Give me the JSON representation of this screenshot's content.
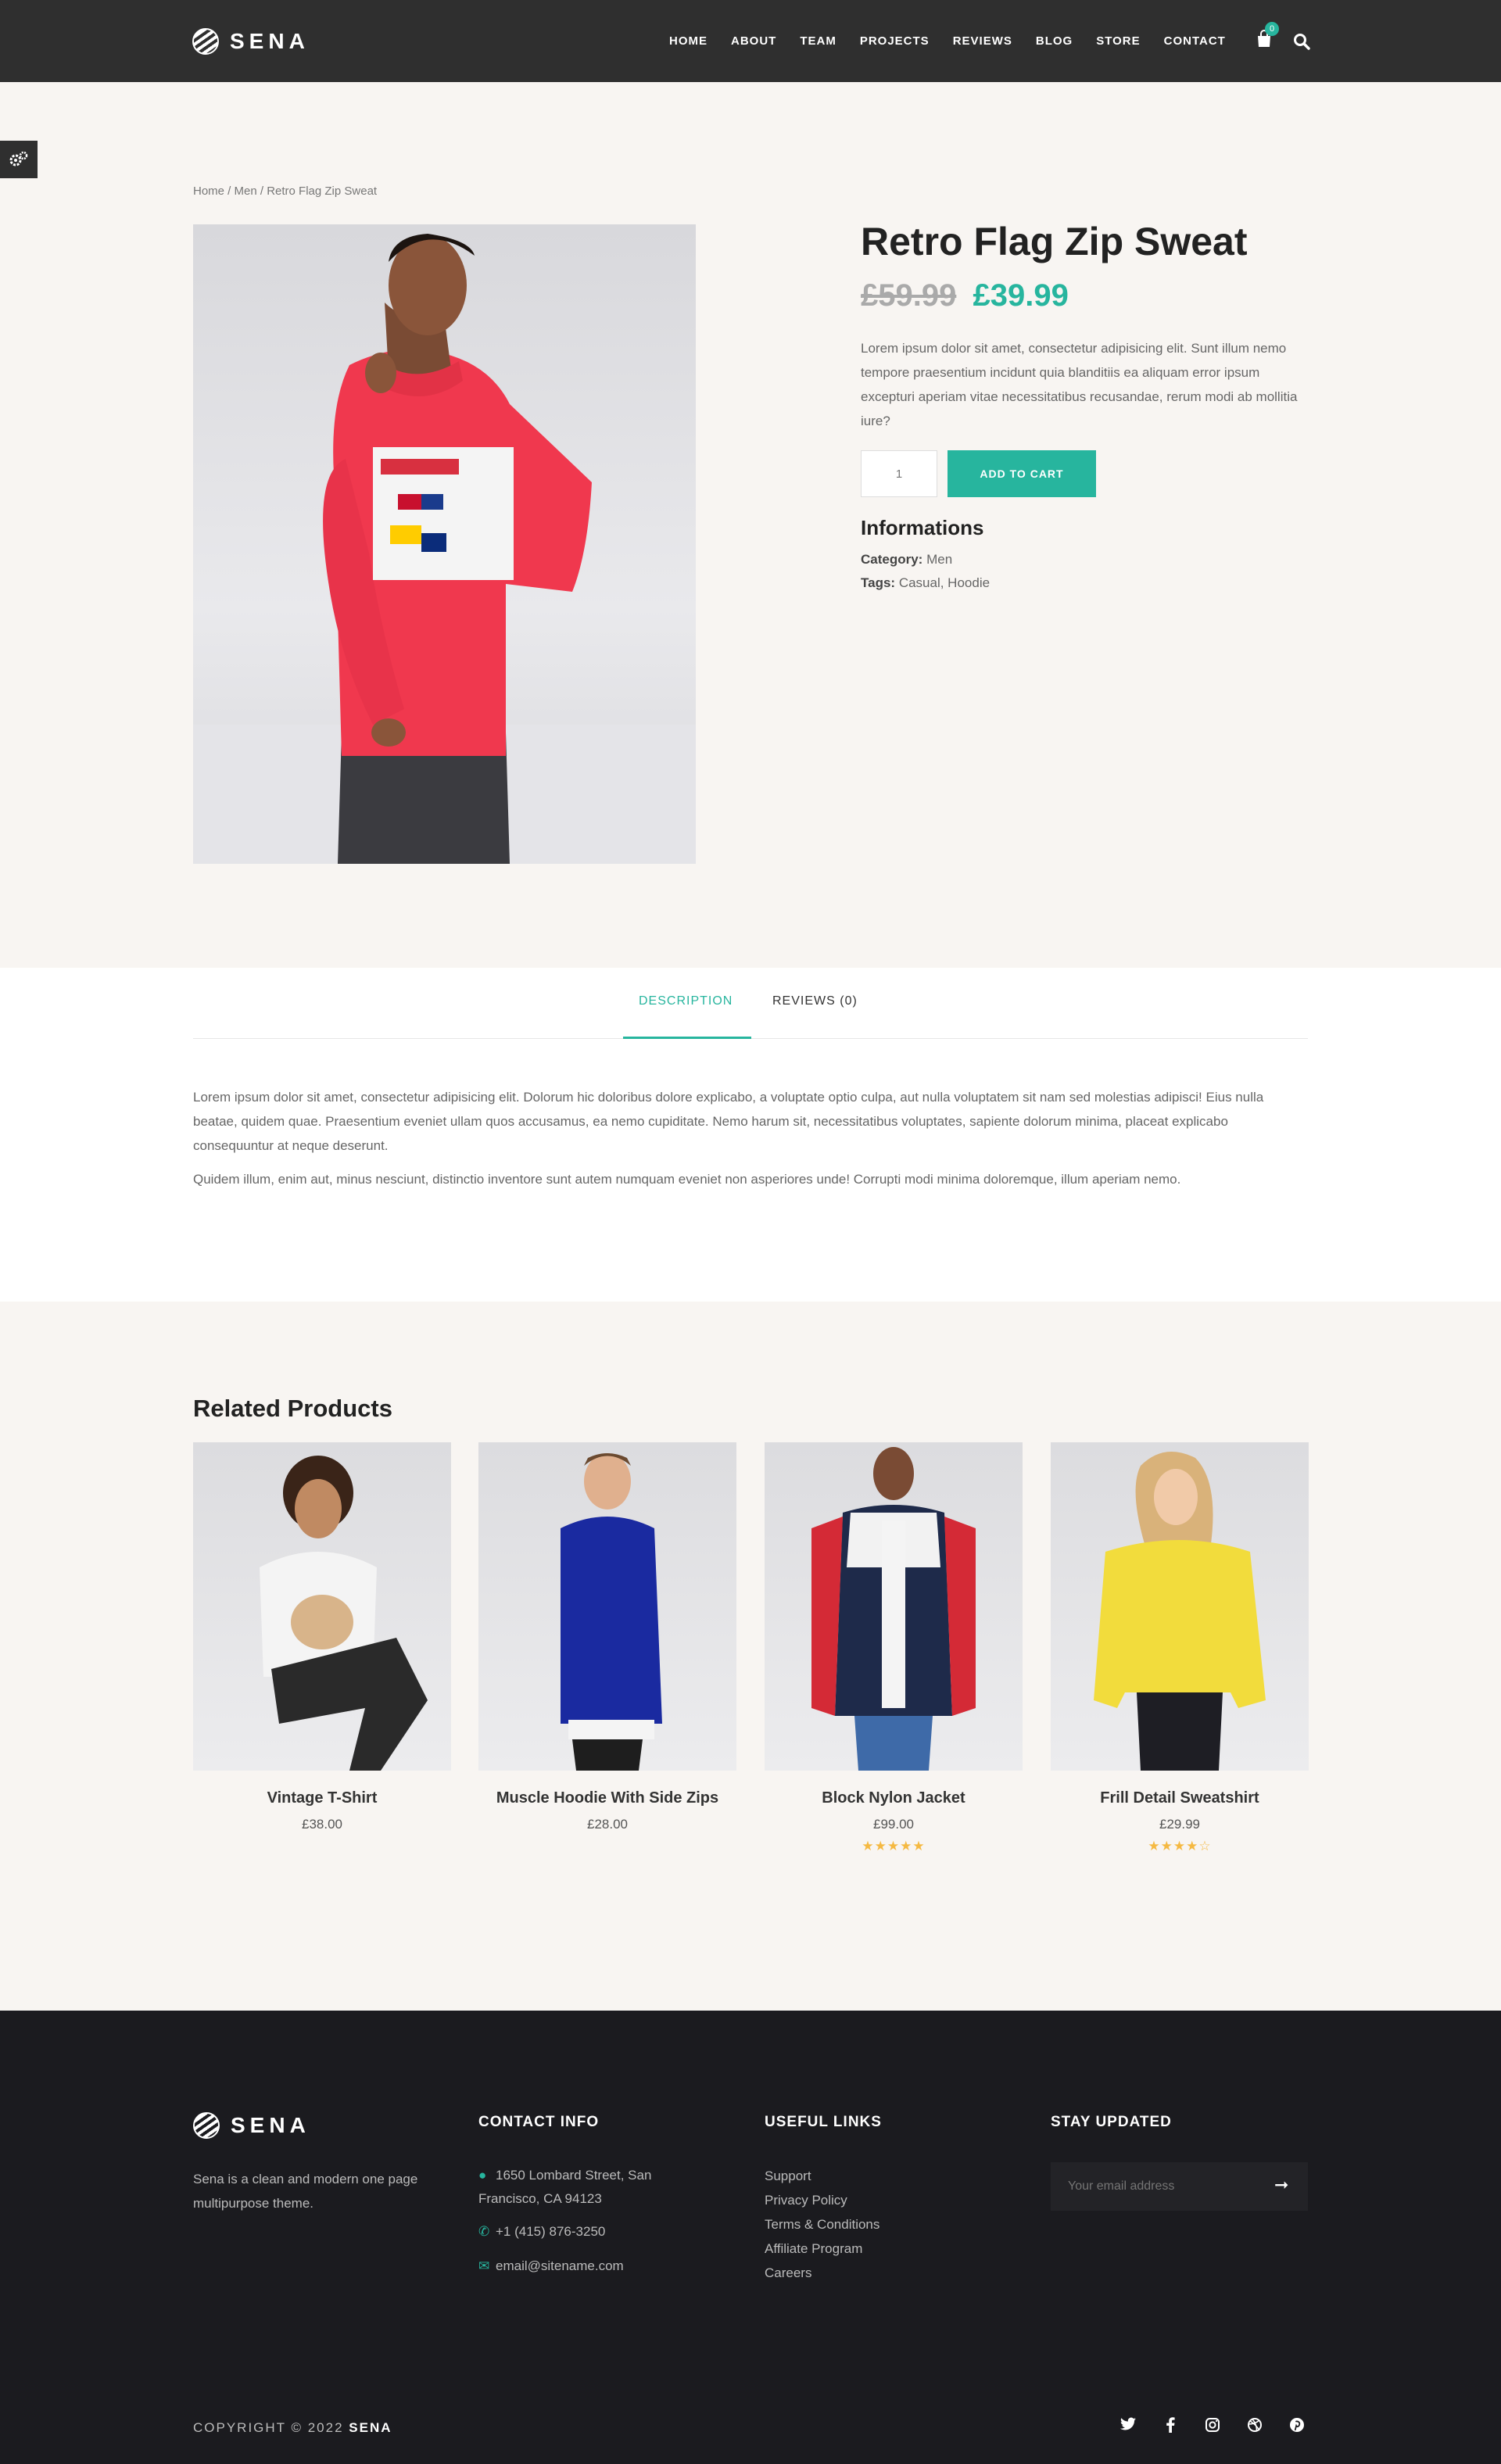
{
  "header": {
    "logo": "SENA",
    "nav": [
      "HOME",
      "ABOUT",
      "TEAM",
      "PROJECTS",
      "REVIEWS",
      "BLOG",
      "STORE",
      "CONTACT"
    ],
    "cart_count": "0",
    "icons": [
      "bag-icon",
      "search-icon"
    ]
  },
  "breadcrumb": "Home / Men / Retro Flag Zip Sweat",
  "product": {
    "title": "Retro Flag Zip Sweat",
    "price_old": "£59.99",
    "price_new": "£39.99",
    "description": "Lorem ipsum dolor sit amet, consectetur adipisicing elit. Sunt illum nemo tempore praesentium incidunt quia blanditiis ea aliquam error ipsum excepturi aperiam vitae necessitatibus recusandae, rerum modi ab mollitia iure?",
    "qty_placeholder": "1",
    "add_to_cart": "ADD TO CART",
    "info_title": "Informations",
    "category_label": "Category:",
    "category_value": "Men",
    "tags_label": "Tags:",
    "tags_value": "Casual, Hoodie",
    "colors": {
      "accent": "#27b59e",
      "sweater": "#f0384e"
    }
  },
  "tabs": {
    "description_label": "DESCRIPTION",
    "reviews_label": "REVIEWS (0)",
    "para1": "Lorem ipsum dolor sit amet, consectetur adipisicing elit. Dolorum hic doloribus dolore explicabo, a voluptate optio culpa, aut nulla voluptatem sit nam sed molestias adipisci! Eius nulla beatae, quidem quae. Praesentium eveniet ullam quos accusamus, ea nemo cupiditate. Nemo harum sit, necessitatibus voluptates, sapiente dolorum minima, placeat explicabo consequuntur at neque deserunt.",
    "para2": "Quidem illum, enim aut, minus nesciunt, distinctio inventore sunt autem numquam eveniet non asperiores unde! Corrupti modi minima doloremque, illum aperiam nemo."
  },
  "related": {
    "title": "Related Products",
    "items": [
      {
        "name": "Vintage T-Shirt",
        "price": "£38.00",
        "rating": ""
      },
      {
        "name": "Muscle Hoodie With Side Zips",
        "price": "£28.00",
        "rating": ""
      },
      {
        "name": "Block Nylon Jacket",
        "price": "£99.00",
        "rating": "★★★★★"
      },
      {
        "name": "Frill Detail Sweatshirt",
        "price": "£29.99",
        "rating": "★★★★☆"
      }
    ]
  },
  "footer": {
    "logo": "SENA",
    "about": "Sena is a clean and modern one page multipurpose theme.",
    "contact_title": "CONTACT INFO",
    "address": "1650 Lombard Street, San Francisco, CA 94123",
    "phone": "+1 (415) 876-3250",
    "email": "email@sitename.com",
    "links_title": "USEFUL LINKS",
    "links": [
      "Support",
      "Privacy Policy",
      "Terms & Conditions",
      "Affiliate Program",
      "Careers"
    ],
    "stay_title": "STAY UPDATED",
    "email_placeholder": "Your email address",
    "copyright_prefix": "COPYRIGHT © 2022",
    "copyright_brand": "SENA",
    "social_icons": [
      "twitter-icon",
      "facebook-icon",
      "instagram-icon",
      "dribbble-icon",
      "pinterest-icon"
    ]
  }
}
